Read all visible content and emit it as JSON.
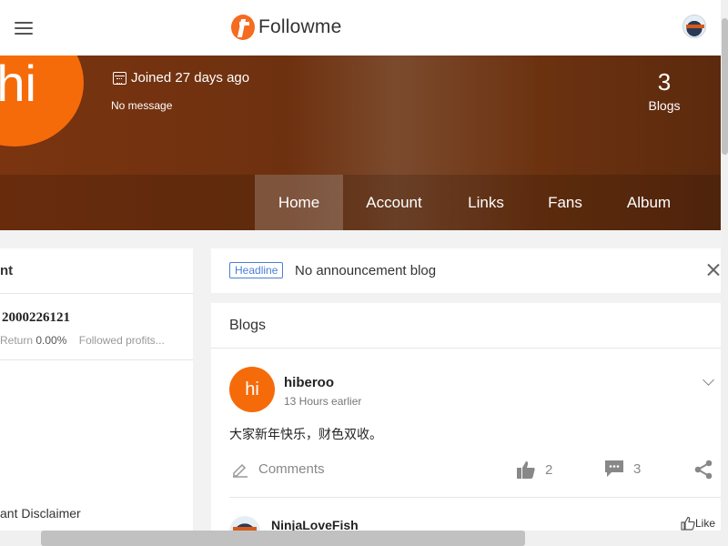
{
  "header": {
    "logo_text": "Followme",
    "menu_icon": "hamburger-menu-icon",
    "avatar_icon": "user-avatar"
  },
  "profile": {
    "avatar_text": "hi",
    "joined": "Joined 27 days ago",
    "message": "No message",
    "blogs_count": "3",
    "blogs_label": "Blogs"
  },
  "nav": {
    "tabs": [
      "Home",
      "Account",
      "Links",
      "Fans",
      "Album"
    ],
    "active": "Home"
  },
  "left_panel": {
    "title": "nt",
    "account_number": "2000226121",
    "return_label": "Return",
    "return_value": "0.00%",
    "followed_label": "Followed profits...",
    "disclaimer": "ant Disclaimer"
  },
  "headline": {
    "tag": "Headline",
    "text": "No announcement blog"
  },
  "blogs": {
    "title": "Blogs",
    "post": {
      "avatar_text": "hi",
      "author": "hiberoo",
      "time": "13 Hours earlier",
      "content": "大家新年快乐，财色双收。",
      "comments_label": "Comments",
      "likes": "2",
      "comments_count": "3"
    },
    "next_post": {
      "author": "NinjaLoveFish",
      "like_label": "Like"
    }
  },
  "colors": {
    "brand_orange": "#f56b0a",
    "banner_brown": "#6e3110",
    "headline_blue": "#4a7fd4"
  }
}
